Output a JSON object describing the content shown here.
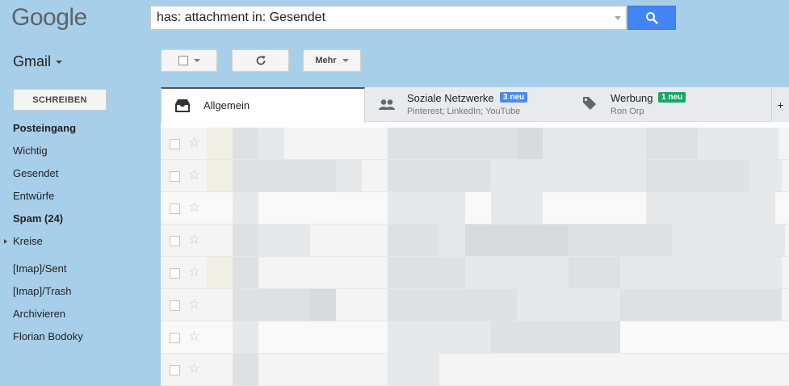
{
  "header": {
    "logo": "Google",
    "search_value": "has: attachment in: Gesendet",
    "search_icon": "search-icon"
  },
  "gmail_menu": {
    "label": "Gmail"
  },
  "toolbar": {
    "select_icon": "checkbox-icon",
    "refresh_icon": "refresh-icon",
    "more_label": "Mehr"
  },
  "sidebar": {
    "compose_label": "SCHREIBEN",
    "items": [
      {
        "label": "Posteingang"
      },
      {
        "label": "Wichtig"
      },
      {
        "label": "Gesendet"
      },
      {
        "label": "Entwürfe"
      },
      {
        "label": "Spam (24)"
      },
      {
        "label": "Kreise"
      },
      {
        "label": "[Imap]/Sent"
      },
      {
        "label": "[Imap]/Trash"
      },
      {
        "label": "Archivieren"
      },
      {
        "label": "Florian Bodoky"
      }
    ]
  },
  "tabs": [
    {
      "label": "Allgemein",
      "icon": "inbox-icon"
    },
    {
      "label": "Soziale Netzwerke",
      "badge": "3 neu",
      "badge_color": "#4a8af4",
      "sub": "Pinterest; LinkedIn; YouTube",
      "icon": "people-icon"
    },
    {
      "label": "Werbung",
      "badge": "1 neu",
      "badge_color": "#16a765",
      "sub": "Ron Orp",
      "icon": "tag-icon"
    }
  ],
  "tab_add_label": "+",
  "colors": {
    "background": "#a8cfe9",
    "search_button": "#4285f4",
    "accent": "#4285f4"
  }
}
